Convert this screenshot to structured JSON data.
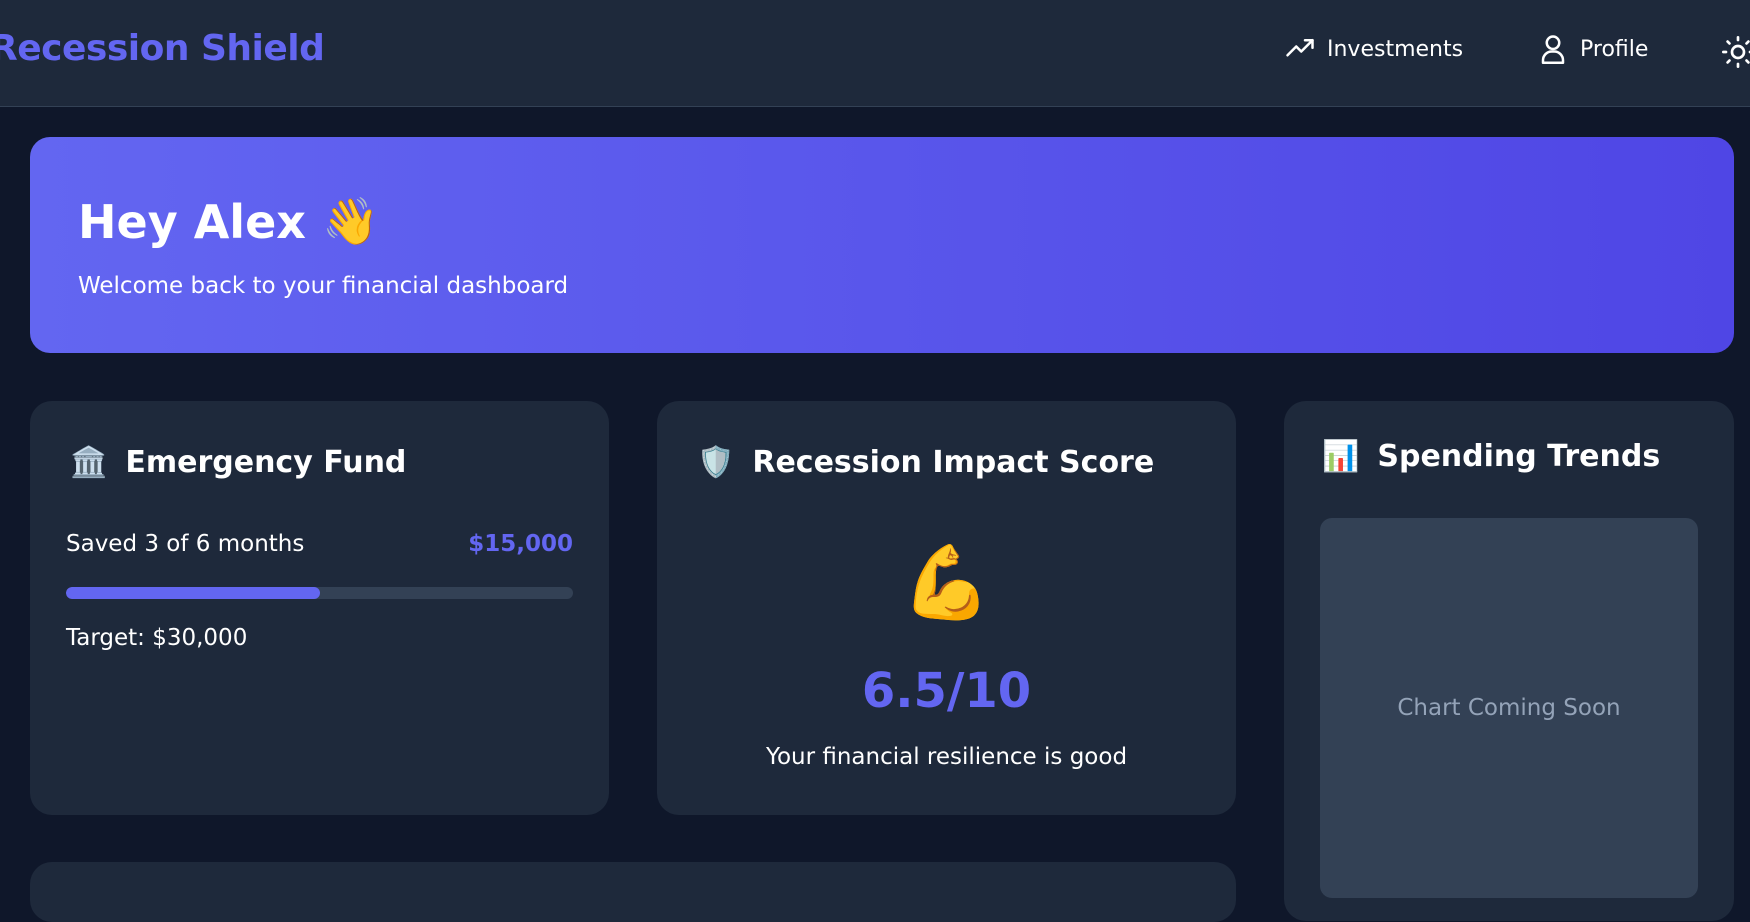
{
  "header": {
    "brand": "Recession Shield",
    "nav": [
      {
        "label": "Investments",
        "icon": "trending-up-icon"
      },
      {
        "label": "Profile",
        "icon": "user-icon"
      },
      {
        "label": "",
        "icon": "sun-icon"
      }
    ]
  },
  "banner": {
    "greeting": "Hey Alex",
    "emoji": "👋",
    "subtitle": "Welcome back to your financial dashboard"
  },
  "emergency_fund": {
    "icon": "🏛️",
    "title": "Emergency Fund",
    "saved_text": "Saved 3 of 6 months",
    "saved_amount": "$15,000",
    "progress_fraction": 0.5,
    "target_text": "Target: $30,000"
  },
  "impact": {
    "icon": "🛡️",
    "title": "Recession Impact Score",
    "emoji": "💪",
    "score": "6.5/10",
    "description": "Your financial resilience is good"
  },
  "spending": {
    "icon": "📊",
    "title": "Spending Trends",
    "placeholder": "Chart Coming Soon"
  },
  "colors": {
    "accent": "#6366f1",
    "background": "#0f172a",
    "card": "#1e293b",
    "muted": "#94a3b8"
  }
}
